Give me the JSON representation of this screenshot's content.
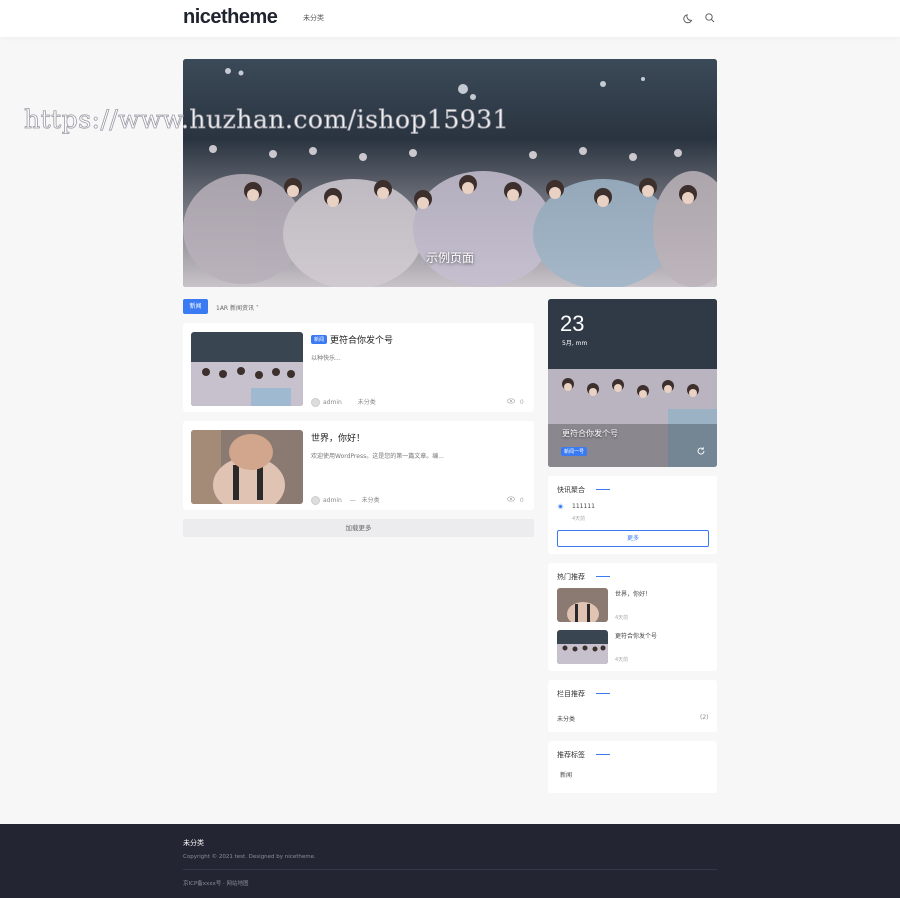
{
  "header": {
    "logo": "nicetheme",
    "nav": [
      "未分类"
    ],
    "icons": [
      "moon-icon",
      "search-icon"
    ]
  },
  "watermark": "https://www.huzhan.com/ishop15931",
  "hero": {
    "caption": "示例页面"
  },
  "tabs": {
    "active": "新闻",
    "other": "1AR 新闻资讯 ˅"
  },
  "posts": [
    {
      "tag": "新闻",
      "title": "更符合你发个号",
      "excerpt": "以种快乐...",
      "author": "admin",
      "category": "未分类",
      "comments": "0"
    },
    {
      "tag": "",
      "title": "世界，你好！",
      "excerpt": "欢迎使用WordPress。这是您的第一篇文章。编...",
      "author": "admin",
      "category": "未分类",
      "comments": "0"
    }
  ],
  "load_more": "加载更多",
  "side_feature": {
    "day": "23",
    "month": "5月, mm",
    "title": "更符合你发个号",
    "tag": "新闻一号"
  },
  "quick_widget": {
    "title": "快讯聚合",
    "item_text": "111111",
    "item_time": "4天前",
    "button": "更多"
  },
  "hot_widget": {
    "title": "热门推荐",
    "items": [
      {
        "title": "世界，你好！",
        "time": "4天前"
      },
      {
        "title": "更符合你发个号",
        "time": "4天前"
      }
    ]
  },
  "category_widget": {
    "title": "栏目推荐",
    "items": [
      {
        "name": "未分类",
        "count": "(2)"
      }
    ]
  },
  "tags_widget": {
    "title": "推荐标签",
    "items": [
      "新闻"
    ]
  },
  "footer": {
    "title": "未分类",
    "copyright": "Copyright © 2021 test. Designed by nicetheme.",
    "links": "京ICP备xxxx号 · 网站地图"
  },
  "colors": {
    "accent": "#3a7bf3",
    "footer_bg": "#232632",
    "page_bg": "#f7f7f8"
  }
}
